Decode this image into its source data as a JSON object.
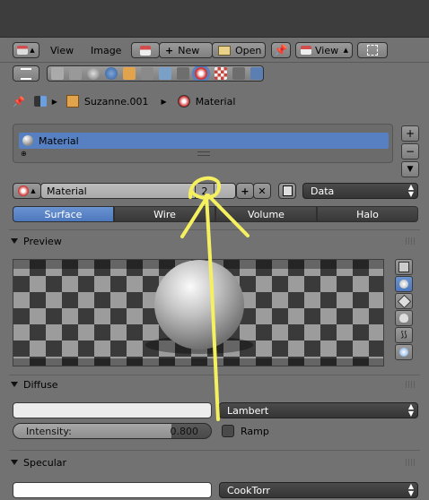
{
  "header": {
    "menu_view": "View",
    "menu_image": "Image",
    "new_label": "New",
    "open_label": "Open",
    "view_label": "View"
  },
  "breadcrumb": {
    "object": "Suzanne.001",
    "material": "Material"
  },
  "slots": {
    "items": [
      "Material"
    ],
    "selected_index": 0
  },
  "datablock": {
    "name": "Material",
    "users": "2",
    "link_label": "Data"
  },
  "tabs": {
    "items": [
      "Surface",
      "Wire",
      "Volume",
      "Halo"
    ],
    "active": "Surface"
  },
  "preview": {
    "title": "Preview"
  },
  "diffuse": {
    "title": "Diffuse",
    "shader": "Lambert",
    "intensity_label": "Intensity:",
    "intensity_value": "0.800",
    "ramp_label": "Ramp"
  },
  "specular": {
    "title": "Specular",
    "shader": "CookTorr"
  },
  "colors": {
    "selection": "#5680c2",
    "annotation": "#f5f060",
    "panel_bg": "#727272"
  }
}
